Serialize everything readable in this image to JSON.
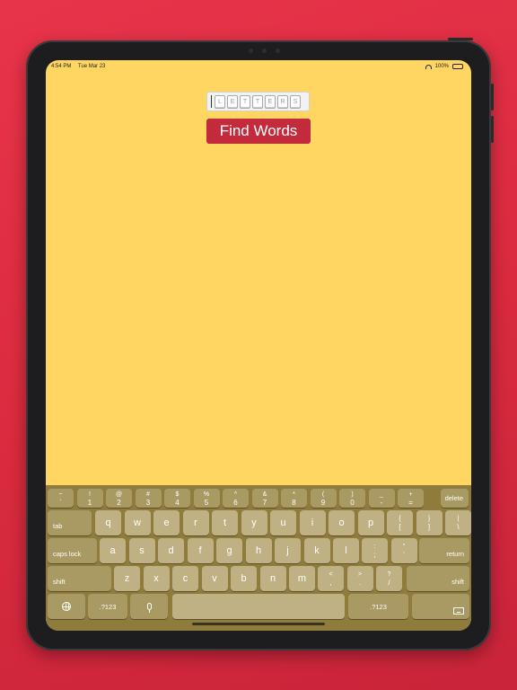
{
  "status_bar": {
    "time": "4:54 PM",
    "date": "Tue Mar 23",
    "battery": "100%",
    "battery_level": 1.0
  },
  "letters_input": {
    "tiles": [
      "L",
      "E",
      "T",
      "T",
      "E",
      "R",
      "S"
    ]
  },
  "find_button": {
    "label": "Find Words"
  },
  "keyboard": {
    "number_row": [
      {
        "top": "~",
        "bottom": "`"
      },
      {
        "top": "!",
        "bottom": "1"
      },
      {
        "top": "@",
        "bottom": "2"
      },
      {
        "top": "#",
        "bottom": "3"
      },
      {
        "top": "$",
        "bottom": "4"
      },
      {
        "top": "%",
        "bottom": "5"
      },
      {
        "top": "^",
        "bottom": "6"
      },
      {
        "top": "&",
        "bottom": "7"
      },
      {
        "top": "*",
        "bottom": "8"
      },
      {
        "top": "(",
        "bottom": "9"
      },
      {
        "top": ")",
        "bottom": "0"
      },
      {
        "top": "_",
        "bottom": "-"
      },
      {
        "top": "+",
        "bottom": "="
      }
    ],
    "delete": "delete",
    "tab": "tab",
    "row_q": [
      "q",
      "w",
      "e",
      "r",
      "t",
      "y",
      "u",
      "i",
      "o",
      "p"
    ],
    "row_q_symbols": [
      {
        "top": "{",
        "bottom": "["
      },
      {
        "top": "}",
        "bottom": "]"
      },
      {
        "top": "|",
        "bottom": "\\"
      }
    ],
    "caps_lock": "caps lock",
    "row_a": [
      "a",
      "s",
      "d",
      "f",
      "g",
      "h",
      "j",
      "k",
      "l"
    ],
    "row_a_symbols": [
      {
        "top": ":",
        "bottom": ";"
      },
      {
        "top": "\"",
        "bottom": "'"
      }
    ],
    "return": "return",
    "shift_left": "shift",
    "row_z": [
      "z",
      "x",
      "c",
      "v",
      "b",
      "n",
      "m"
    ],
    "row_z_symbols": [
      {
        "top": "<",
        "bottom": ","
      },
      {
        "top": ">",
        "bottom": "."
      },
      {
        "top": "?",
        "bottom": "/"
      }
    ],
    "shift_right": "shift",
    "numbers_left": ".?123",
    "numbers_right": ".?123",
    "icons": {
      "globe": "globe-icon",
      "mic": "microphone-icon",
      "dismiss": "keyboard-dismiss-icon"
    }
  },
  "colors": {
    "background": "#e0303f",
    "screen": "#ffd661",
    "button": "#c32a3c",
    "keyboard": "#8f7c3d"
  }
}
